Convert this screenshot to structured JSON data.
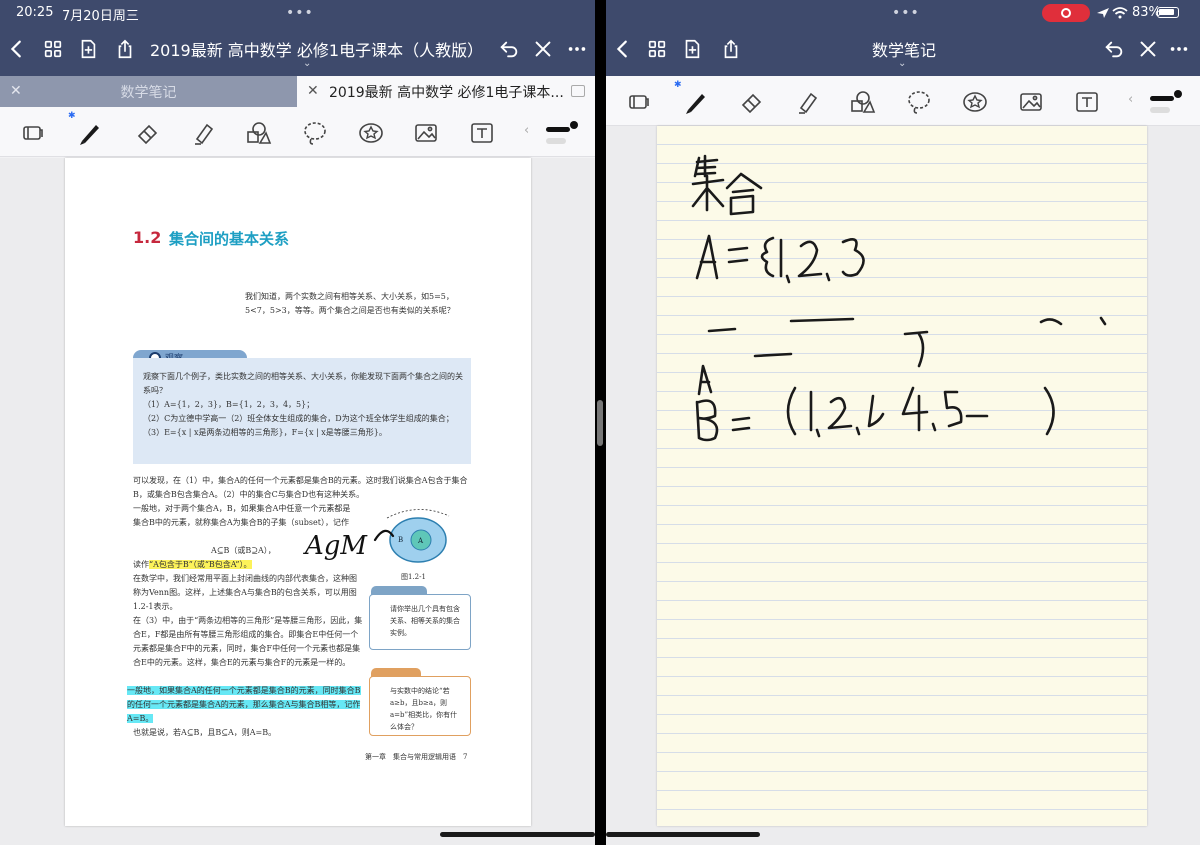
{
  "status": {
    "time": "20:25",
    "date": "7月20日周三",
    "battery": "83%"
  },
  "left": {
    "title": "2019最新 高中数学 必修1电子课本（人教版）",
    "tabs": [
      {
        "label": "数学笔记",
        "active": false
      },
      {
        "label": "2019最新 高中数学 必修1电子课本...",
        "active": true
      }
    ],
    "page": {
      "section_number": "1.2",
      "section_title": "集合间的基本关系",
      "intro": "我们知道，两个实数之间有相等关系、大小关系，如5=5，5<7，5>3，等等。两个集合之间是否也有类似的关系呢？",
      "observe_label": "观察",
      "observe_lines": [
        "观察下面几个例子，类比实数之间的相等关系、大小关系，你能发现下面两个集合之间的关系吗？",
        "（1）A={1，2，3}，B={1，2，3，4，5}；",
        "（2）C为立德中学高一（2）班全体女生组成的集合，D为这个班全体学生组成的集合；",
        "（3）E={x | x是两条边相等的三角形}，F={x | x是等腰三角形}。"
      ],
      "para1": "可以发现，在（1）中，集合A的任何一个元素都是集合B的元素。这时我们说集合A包含于集合B，或集合B包含集合A。（2）中的集合C与集合D也有这种关系。",
      "para2": "一般地，对于两个集合A，B，如果集合A中任意一个元素都是集合B中的元素，就称集合A为集合B的子集（subset），记作",
      "formula": "A⊆B（或B⊇A），",
      "read_as_prefix": "读作",
      "read_as": "“A包含于B”（或“B包含A”）。",
      "para3": "在数学中，我们经常用平面上封闭曲线的内部代表集合，这种图称为Venn图。这样，上述集合A与集合B的包含关系，可以用图1.2-1表示。",
      "para4": "在（3）中，由于“两条边相等的三角形”是等腰三角形，因此，集合E，F都是由所有等腰三角形组成的集合。即集合E中任何一个元素都是集合F中的元素，同时，集合F中任何一个元素也都是集合E中的元素。这样，集合E的元素与集合F的元素是一样的。",
      "para5": "一般地，如果集合A的任何一个元素都是集合B的元素，同时集合B的任何一个元素都是集合A的元素，那么集合A与集合B相等，记作A=B。",
      "para6": "也就是说，若A⊆B，且B⊆A，则A=B。",
      "figure_caption": "图1.2-1",
      "venn_outer": "B",
      "venn_inner": "A",
      "side_note1": "请你举出几个具有包含关系、相等关系的集合实例。",
      "side_note2": "与实数中的结论“若a≥b，且b≥a，则a=b”相类比，你有什么体会？",
      "footer": "第一章　集合与常用逻辑用语　7",
      "handwriting": "AgM"
    }
  },
  "right": {
    "title": "数学笔记"
  },
  "toolbar_tools": [
    "page-view-icon",
    "pen-icon",
    "eraser-icon",
    "highlighter-icon",
    "shapes-icon",
    "lasso-icon",
    "sticker-icon",
    "image-icon",
    "text-icon"
  ],
  "colors": {
    "nav": "#3e4a6c",
    "accent_red": "#c6283d",
    "accent_blue": "#1e9fc3",
    "highlight_yellow": "#fcf25a",
    "highlight_cyan": "#67e8f5",
    "record": "#e02f3b"
  }
}
